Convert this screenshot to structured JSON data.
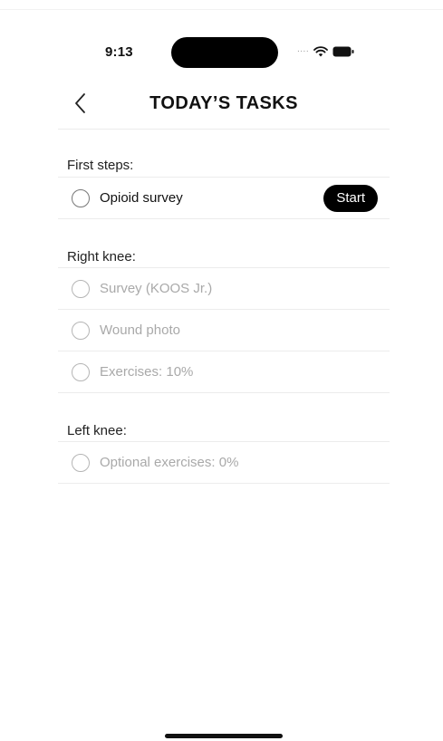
{
  "status_bar": {
    "time": "9:13",
    "signal": "....",
    "icons": [
      "wifi-icon",
      "battery-icon"
    ]
  },
  "header": {
    "back_icon": "chevron-left-icon",
    "title": "TODAY’S TASKS"
  },
  "sections": [
    {
      "title": "First steps:",
      "tasks": [
        {
          "label": "Opioid survey",
          "active": true,
          "action": "Start"
        }
      ]
    },
    {
      "title": "Right knee:",
      "tasks": [
        {
          "label": "Survey (KOOS Jr.)",
          "active": false
        },
        {
          "label": "Wound photo",
          "active": false
        },
        {
          "label": "Exercises: 10%",
          "active": false
        }
      ]
    },
    {
      "title": "Left knee:",
      "tasks": [
        {
          "label": "Optional exercises: 0%",
          "active": false
        }
      ]
    }
  ],
  "colors": {
    "active_text": "#111111",
    "inactive_text": "#a9a9a9",
    "button_bg": "#000000",
    "button_text": "#ffffff",
    "divider": "#ececec"
  }
}
